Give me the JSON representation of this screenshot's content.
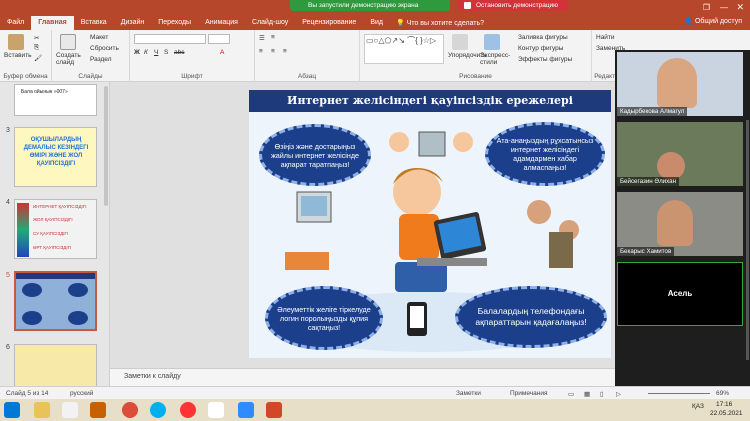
{
  "window": {
    "autosave": "Файл",
    "tabs": [
      "Файл",
      "Главная",
      "Вставка",
      "Дизайн",
      "Переходы",
      "Анимация",
      "Слайд-шоу",
      "Рецензирование",
      "Вид"
    ],
    "active_tab": "Главная",
    "tell_me": "Что вы хотите сделать?",
    "share": "Общий доступ",
    "share_banner": "Вы запустили демонстрацию экрана",
    "stop_banner": "Остановить демонстрацию"
  },
  "ribbon": {
    "groups": {
      "clipboard": "Буфер обмена",
      "slides": "Слайды",
      "font": "Шрифт",
      "paragraph": "Абзац",
      "drawing": "Рисование",
      "editing": "Редакт..."
    },
    "paste": "Вставить",
    "new_slide": "Создать слайд",
    "layout": "Макет",
    "reset": "Сбросить",
    "section": "Раздел",
    "arrange": "Упорядочить",
    "quick_styles": "Экспресс-стили",
    "shape_fill": "Заливка фигуры",
    "shape_outline": "Контур фигуры",
    "shape_effects": "Эффекты фигуры",
    "find": "Найти",
    "replace": "Заменить"
  },
  "thumbnails": [
    {
      "num": "",
      "label": "Бала ойынын »007»"
    },
    {
      "num": "3",
      "label": "ОҚУШЫЛАРДЫҢ ДЕМАЛЫС КЕЗІНДЕГІ ӨМІРІ ЖӘНЕ ЖОЛ ҚАУІПСІЗДІГІ"
    },
    {
      "num": "4",
      "items": [
        "ИНТЕРНЕТ ҚАУІПСІЗДІГІ",
        "ЖОЛ ҚАУІПСІЗДІГІ",
        "СУ ҚАУІПСІЗДІГІ",
        "ӨРТ ҚАУІПСІЗДІГІ"
      ]
    },
    {
      "num": "5",
      "label": ""
    },
    {
      "num": "6",
      "label": ""
    }
  ],
  "slide": {
    "title": "Интернет желісіндегі қауіпсіздік ережелері",
    "bubble_tl": "Өзіңіз және достарыңыз жайлы интернет желісінде ақпарат таратпаңыз!",
    "bubble_tr": "Ата-анаңыздың рұхсатынсыз интернет желісіндегі адамдармен хабар алмаспаңыз!",
    "bubble_bl": "Әлеуметтік желіге тіркелуде логин поролыңызды құпия сақтаңыз!",
    "bubble_br": "Балалардың телефондағы ақпараттарын қадағалаңыз!"
  },
  "notes": "Заметки к слайду",
  "participants": [
    {
      "name": "Кадырбекова Алмагул"
    },
    {
      "name": "Бейсегазин Әлихан"
    },
    {
      "name": "Бекарыс Хамитов"
    },
    {
      "name": "Асель"
    }
  ],
  "status": {
    "slide_counter": "Слайд 5 из 14",
    "language": "русский",
    "notes_btn": "Заметки",
    "comments_btn": "Примечания",
    "zoom": "69%"
  },
  "taskbar": {
    "time": "17:16",
    "date": "22.05.2021",
    "lang": "ҚАЗ"
  },
  "colors": {
    "ribbon": "#b7472a",
    "slide_title": "#1f3a7a",
    "bubble": "#1b3f8b",
    "share_green": "#2f9a3d",
    "stop_red": "#d13438"
  }
}
